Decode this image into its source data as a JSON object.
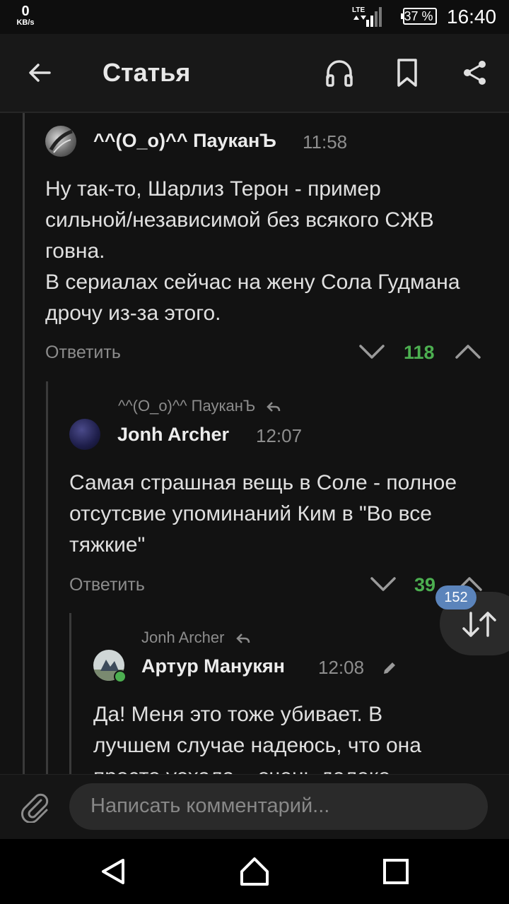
{
  "status_bar": {
    "net_speed_value": "0",
    "net_speed_unit": "KB/s",
    "network": "LTE",
    "battery": "37 %",
    "time": "16:40"
  },
  "toolbar": {
    "title": "Статья",
    "icons": [
      "back-arrow-icon",
      "headphones-icon",
      "bookmark-icon",
      "share-icon"
    ]
  },
  "comments": [
    {
      "author": "^^(O_o)^^ ПауканЪ",
      "time": "11:58",
      "text": [
        "Ну так-то, Шарлиз Терон - пример",
        "сильной/независимой без всякого СЖВ",
        "говна.",
        "В сериалах сейчас на жену Сола Гудмана",
        "дрочу из-за этого."
      ],
      "reply_label": "Ответить",
      "score": "118"
    },
    {
      "reply_to": "^^(O_o)^^ ПауканЪ",
      "author": "Jonh Archer",
      "time": "12:07",
      "text": [
        "Самая страшная вещь в Соле - полное",
        "отсутсвие упоминаний Ким в \"Во все",
        "тяжкие\""
      ],
      "reply_label": "Ответить",
      "score": "39"
    },
    {
      "reply_to": "Jonh Archer",
      "author": "Артур Манукян",
      "time": "12:08",
      "text": [
        "Да! Меня это тоже убивает. В",
        "лучшем случае надеюсь, что она",
        "просто уехала... очень далеко"
      ],
      "online": true
    }
  ],
  "fab": {
    "badge": "152",
    "icon": "sort-arrows-icon"
  },
  "comment_input": {
    "placeholder": "Написать комментарий..."
  },
  "colors": {
    "background": "#121212",
    "score_green": "#4caf50",
    "badge_blue": "#5b84bb"
  }
}
